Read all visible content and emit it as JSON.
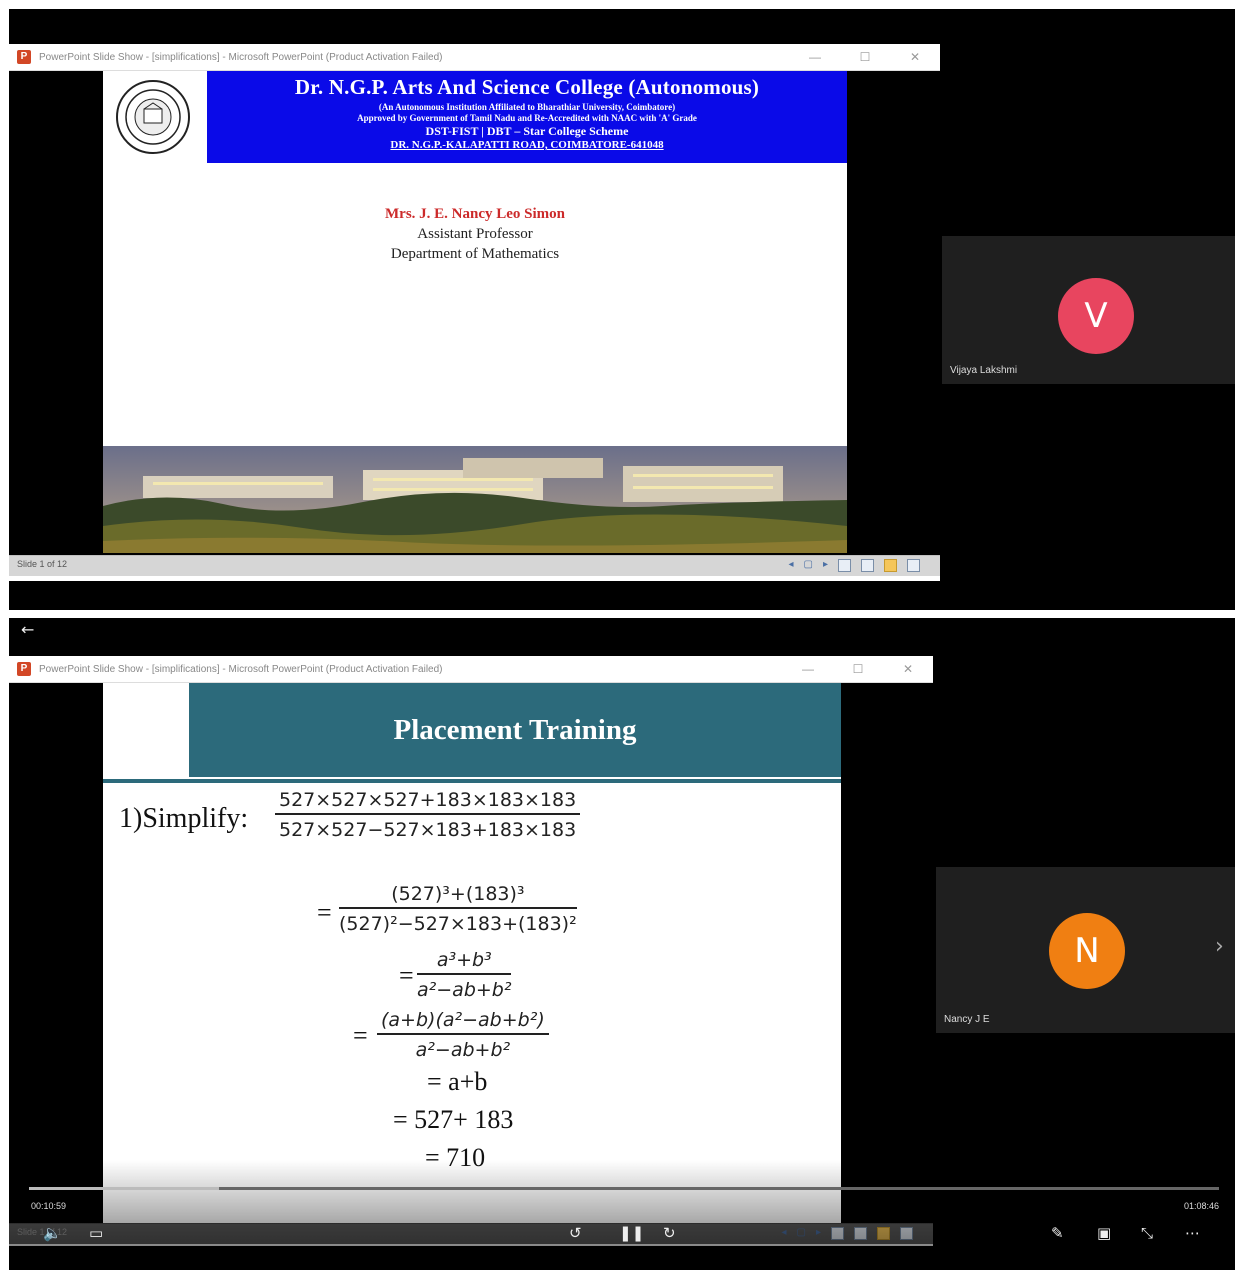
{
  "top": {
    "window_title": "PowerPoint Slide Show - [simplifications] - Microsoft PowerPoint (Product Activation Failed)",
    "window_controls": [
      "—",
      "☐",
      "✕"
    ],
    "banner": {
      "college": "Dr. N.G.P. Arts And Science College (Autonomous)",
      "line2": "(An Autonomous Institution Affiliated to Bharathiar University, Coimbatore)",
      "line3": "Approved by Government of Tamil Nadu and Re-Accredited with NAAC with 'A' Grade",
      "line4": "DST-FIST | DBT – Star College Scheme",
      "line5": "DR. N.G.P.-KALAPATTI ROAD, COIMBATORE-641048"
    },
    "presenter": {
      "name": "Mrs. J. E. Nancy Leo Simon",
      "role": "Assistant Professor",
      "dept": "Department of Mathematics"
    },
    "status": "Slide 1 of 12",
    "participant": {
      "initial": "V",
      "name": "Vijaya Lakshmi",
      "color": "#e8455f"
    }
  },
  "bottom": {
    "back_icon": "←",
    "window_title": "PowerPoint Slide Show - [simplifications] - Microsoft PowerPoint (Product Activation Failed)",
    "window_controls": [
      "—",
      "☐",
      "✕"
    ],
    "slide_title": "Placement Training",
    "problem_label": "1)Simplify:",
    "problem_num": "527×527×527+183×183×183",
    "problem_den": "527×527−527×183+183×183",
    "step1_num": "(527)³+(183)³",
    "step1_den": "(527)²−527×183+(183)²",
    "step2_num": "a³+b³",
    "step2_den": "a²−ab+b²",
    "step3_num": "(a+b)(a²−ab+b²)",
    "step3_den": "a²−ab+b²",
    "equals": "=",
    "step4": "= a+b",
    "step5": "= 527+ 183",
    "step6": "= 710",
    "status": "Slide 1 of 12",
    "participant": {
      "initial": "N",
      "name": "Nancy J E",
      "color": "#f07f12"
    },
    "player": {
      "elapsed": "00:10:59",
      "total": "01:08:46",
      "progress_fraction": 0.16
    }
  }
}
